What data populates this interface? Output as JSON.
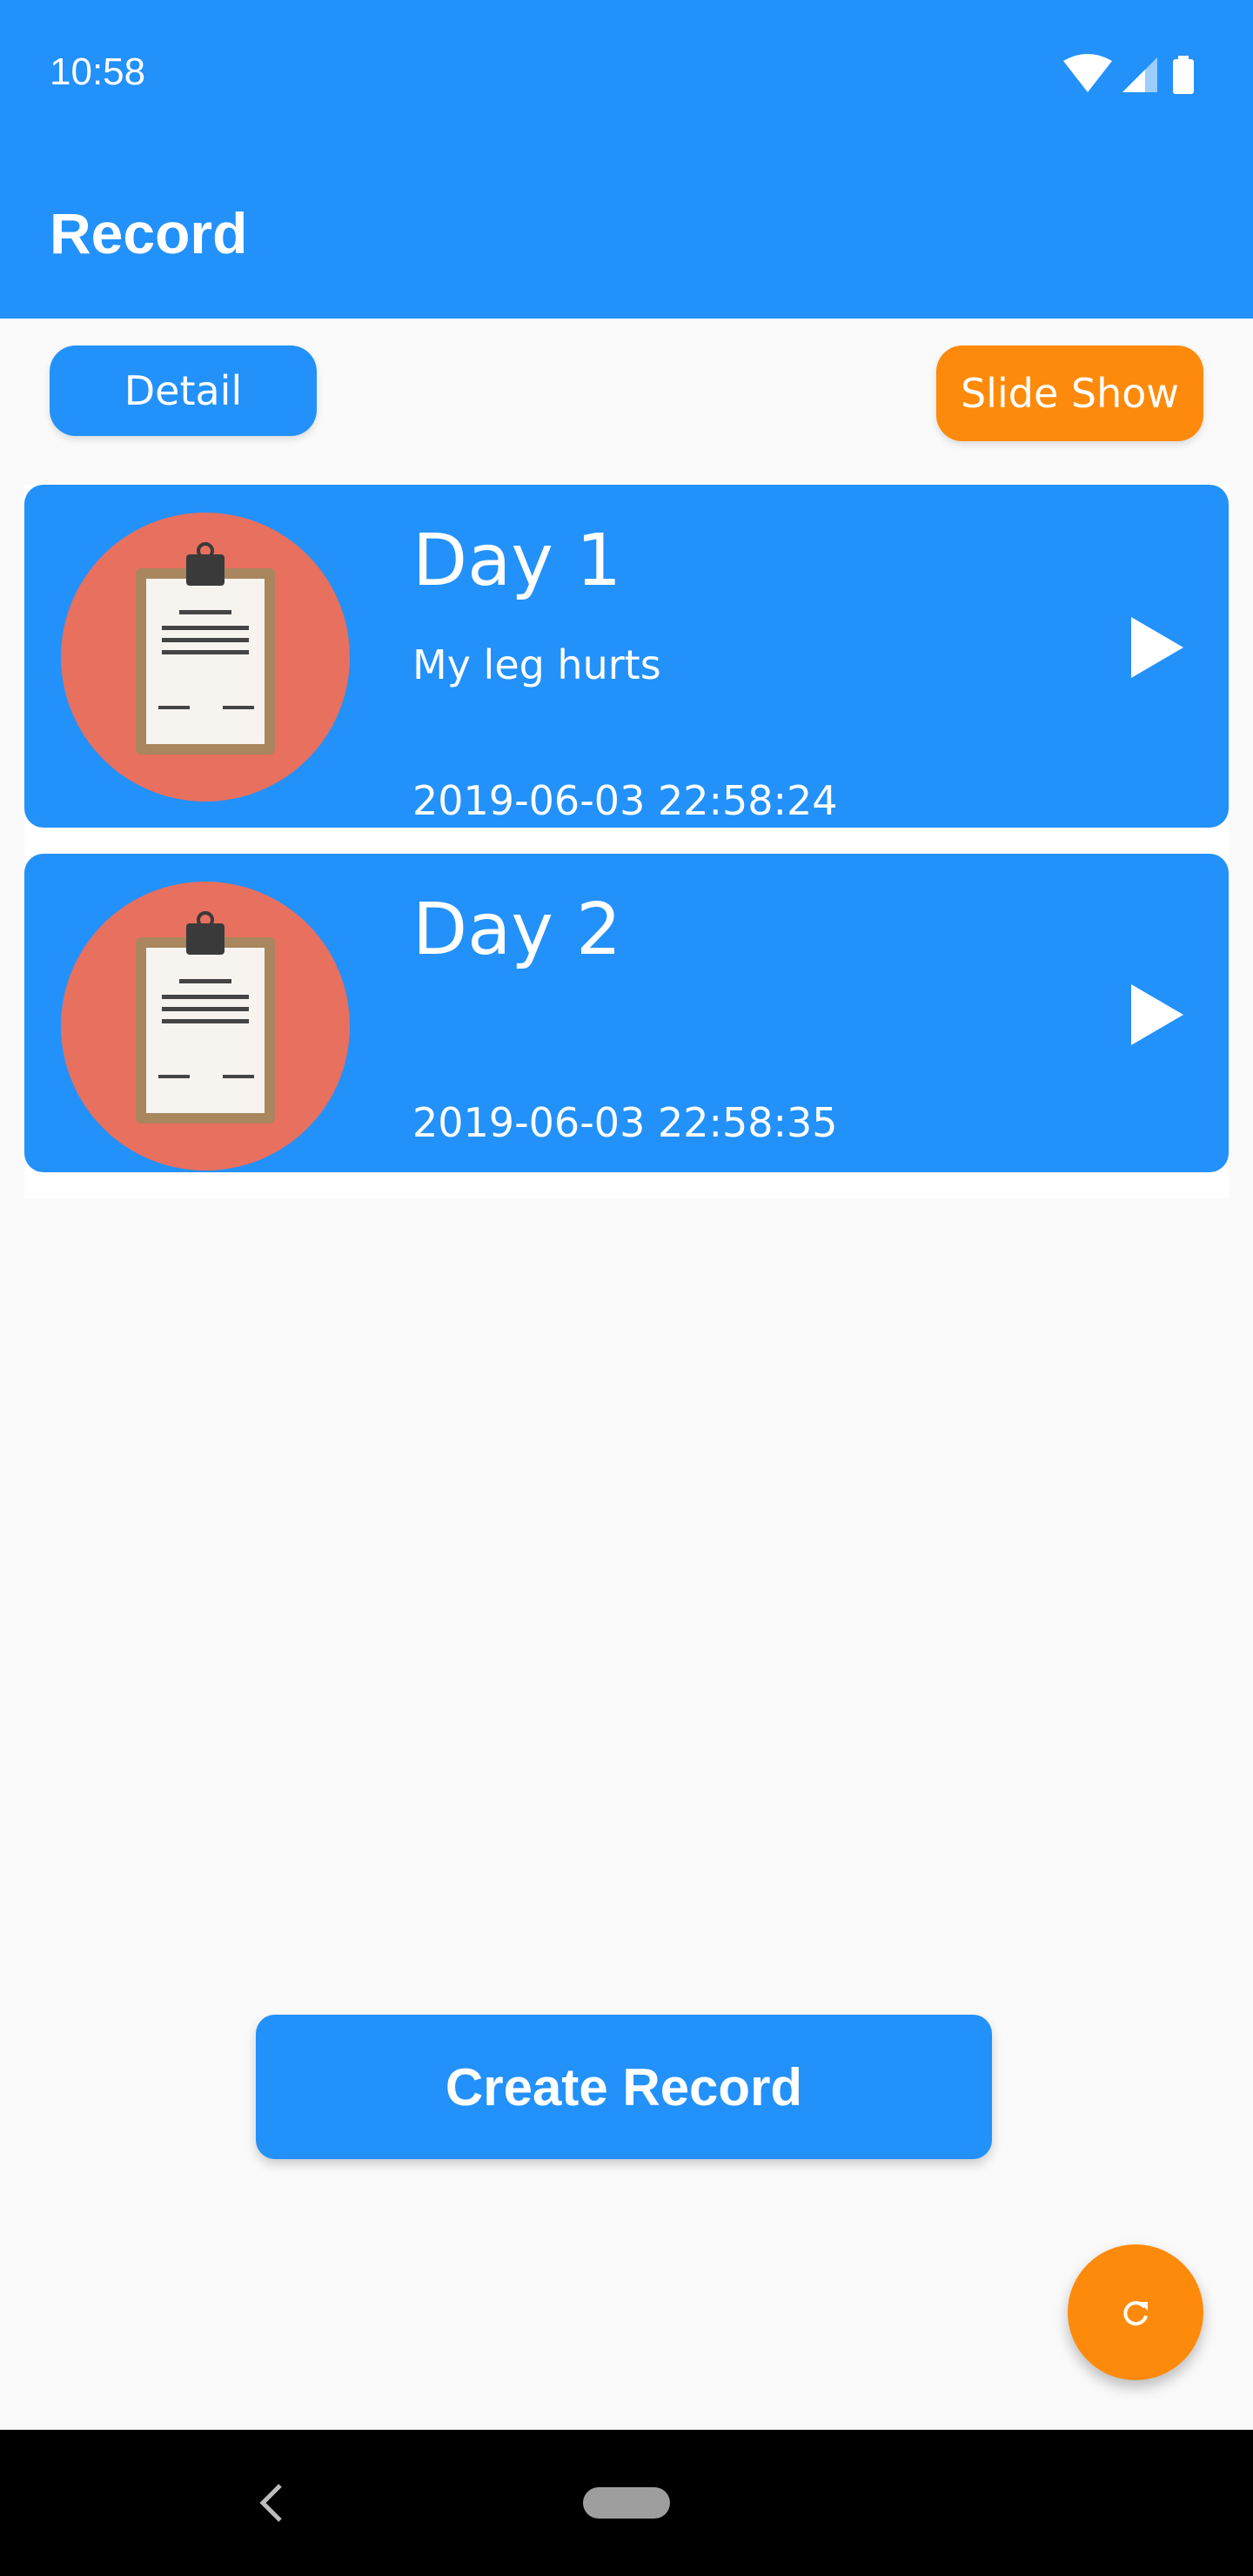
{
  "status_bar": {
    "time": "10:58",
    "icons": [
      "wifi-icon",
      "signal-icon",
      "battery-icon"
    ]
  },
  "app_bar": {
    "title": "Record"
  },
  "actions": {
    "detail_label": "Detail",
    "slideshow_label": "Slide Show"
  },
  "records": [
    {
      "title": "Day 1",
      "note": "My leg hurts",
      "timestamp": "2019-06-03 22:58:24",
      "icon": "clipboard-icon"
    },
    {
      "title": "Day 2",
      "note": "",
      "timestamp": "2019-06-03 22:58:35",
      "icon": "clipboard-icon"
    }
  ],
  "create_button_label": "Create Record",
  "fab_icon": "refresh-icon",
  "nav": {
    "back_icon": "back-chevron-icon",
    "home_icon": "home-pill-icon"
  },
  "colors": {
    "primary": "#2391fa",
    "accent": "#fe8a0b",
    "thumb_circle": "#e8705e",
    "background": "#fafafa"
  }
}
